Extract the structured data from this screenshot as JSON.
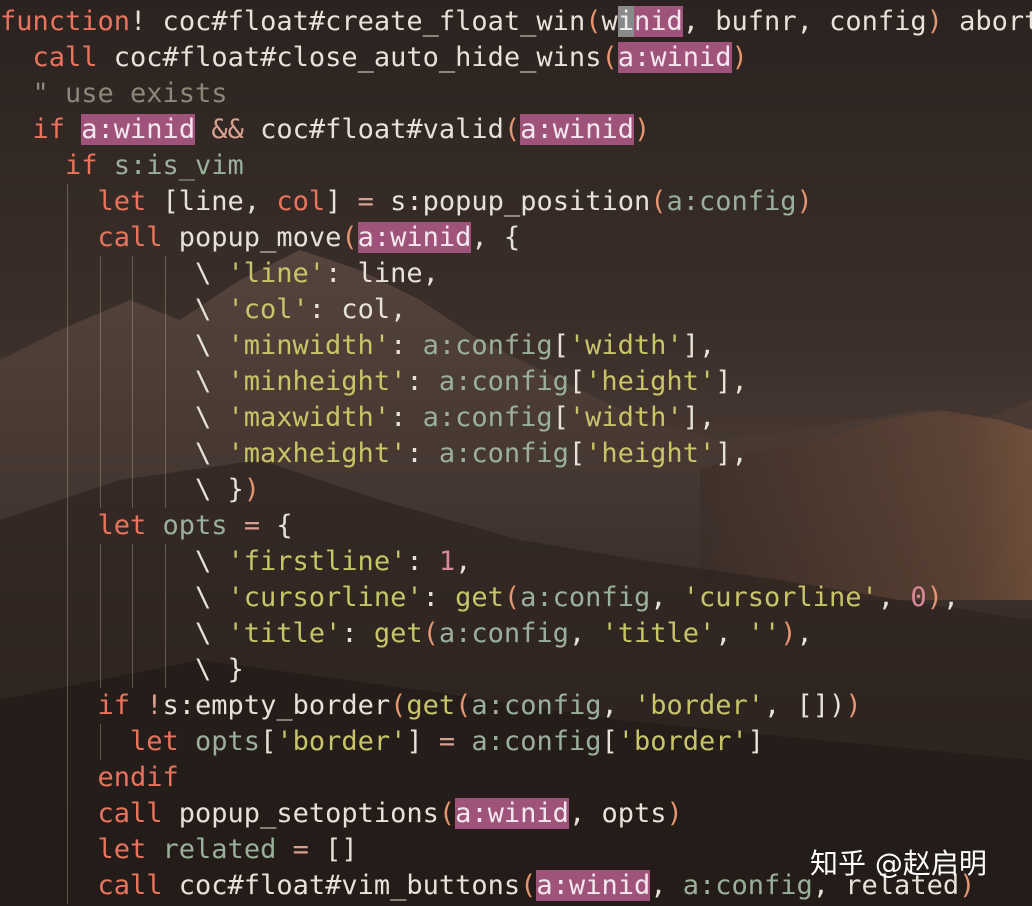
{
  "theme": {
    "background": "#2a2220",
    "keyword": "#e8745e",
    "string": "#c8c46a",
    "variable": "#9ab09a",
    "comment": "#8e8678",
    "number": "#d98a9a",
    "highlight": "#a0537a"
  },
  "editor": {
    "lines": [
      {
        "indent": 0,
        "tokens": [
          {
            "t": "function",
            "c": "kw"
          },
          {
            "t": "! coc#float#create_float_win",
            "c": "fn"
          },
          {
            "t": "(",
            "c": "paren"
          },
          {
            "t": "w",
            "c": "fn"
          },
          {
            "t": "i",
            "c": "cur"
          },
          {
            "t": "nid",
            "c": "hl"
          },
          {
            "t": ", bufnr, config",
            "c": "fn"
          },
          {
            "t": ")",
            "c": "paren"
          },
          {
            "t": " abort",
            "c": "fn"
          }
        ]
      },
      {
        "indent": 1,
        "tokens": [
          {
            "t": "call",
            "c": "kw"
          },
          {
            "t": " coc#float#close_auto_hide_wins",
            "c": "fn"
          },
          {
            "t": "(",
            "c": "paren"
          },
          {
            "t": "a:winid",
            "c": "hl"
          },
          {
            "t": ")",
            "c": "paren"
          }
        ]
      },
      {
        "indent": 1,
        "tokens": [
          {
            "t": "\" use exists",
            "c": "cmt"
          }
        ]
      },
      {
        "indent": 1,
        "tokens": [
          {
            "t": "if",
            "c": "kw"
          },
          {
            "t": " ",
            "c": "fn"
          },
          {
            "t": "a:winid",
            "c": "hl"
          },
          {
            "t": " && ",
            "c": "op"
          },
          {
            "t": "coc#float#valid",
            "c": "fn"
          },
          {
            "t": "(",
            "c": "paren"
          },
          {
            "t": "a:winid",
            "c": "hl"
          },
          {
            "t": ")",
            "c": "paren"
          }
        ]
      },
      {
        "indent": 2,
        "tokens": [
          {
            "t": "if",
            "c": "kw"
          },
          {
            "t": " s:is_vim",
            "c": "var"
          }
        ]
      },
      {
        "indent": 3,
        "tokens": [
          {
            "t": "let",
            "c": "kw"
          },
          {
            "t": " [line, ",
            "c": "fn"
          },
          {
            "t": "col",
            "c": "kw"
          },
          {
            "t": "] ",
            "c": "fn"
          },
          {
            "t": "=",
            "c": "op"
          },
          {
            "t": " s:popup_position",
            "c": "fn"
          },
          {
            "t": "(",
            "c": "paren"
          },
          {
            "t": "a:config",
            "c": "var"
          },
          {
            "t": ")",
            "c": "paren"
          }
        ]
      },
      {
        "indent": 3,
        "tokens": [
          {
            "t": "call",
            "c": "kw"
          },
          {
            "t": " popup_move",
            "c": "fn"
          },
          {
            "t": "(",
            "c": "paren"
          },
          {
            "t": "a:winid",
            "c": "hl"
          },
          {
            "t": ", {",
            "c": "fn"
          }
        ]
      },
      {
        "indent": 6,
        "tokens": [
          {
            "t": "\\ ",
            "c": "fn"
          },
          {
            "t": "'line'",
            "c": "str"
          },
          {
            "t": ": line,",
            "c": "fn"
          }
        ]
      },
      {
        "indent": 6,
        "tokens": [
          {
            "t": "\\ ",
            "c": "fn"
          },
          {
            "t": "'col'",
            "c": "str"
          },
          {
            "t": ": col,",
            "c": "fn"
          }
        ]
      },
      {
        "indent": 6,
        "tokens": [
          {
            "t": "\\ ",
            "c": "fn"
          },
          {
            "t": "'minwidth'",
            "c": "str"
          },
          {
            "t": ": ",
            "c": "fn"
          },
          {
            "t": "a:config",
            "c": "var"
          },
          {
            "t": "[",
            "c": "fn"
          },
          {
            "t": "'width'",
            "c": "str"
          },
          {
            "t": "],",
            "c": "fn"
          }
        ]
      },
      {
        "indent": 6,
        "tokens": [
          {
            "t": "\\ ",
            "c": "fn"
          },
          {
            "t": "'minheight'",
            "c": "str"
          },
          {
            "t": ": ",
            "c": "fn"
          },
          {
            "t": "a:config",
            "c": "var"
          },
          {
            "t": "[",
            "c": "fn"
          },
          {
            "t": "'height'",
            "c": "str"
          },
          {
            "t": "],",
            "c": "fn"
          }
        ]
      },
      {
        "indent": 6,
        "tokens": [
          {
            "t": "\\ ",
            "c": "fn"
          },
          {
            "t": "'maxwidth'",
            "c": "str"
          },
          {
            "t": ": ",
            "c": "fn"
          },
          {
            "t": "a:config",
            "c": "var"
          },
          {
            "t": "[",
            "c": "fn"
          },
          {
            "t": "'width'",
            "c": "str"
          },
          {
            "t": "],",
            "c": "fn"
          }
        ]
      },
      {
        "indent": 6,
        "tokens": [
          {
            "t": "\\ ",
            "c": "fn"
          },
          {
            "t": "'maxheight'",
            "c": "str"
          },
          {
            "t": ": ",
            "c": "fn"
          },
          {
            "t": "a:config",
            "c": "var"
          },
          {
            "t": "[",
            "c": "fn"
          },
          {
            "t": "'height'",
            "c": "str"
          },
          {
            "t": "],",
            "c": "fn"
          }
        ]
      },
      {
        "indent": 6,
        "tokens": [
          {
            "t": "\\ }",
            "c": "fn"
          },
          {
            "t": ")",
            "c": "paren"
          }
        ]
      },
      {
        "indent": 3,
        "tokens": [
          {
            "t": "let",
            "c": "kw"
          },
          {
            "t": " opts ",
            "c": "var"
          },
          {
            "t": "=",
            "c": "op"
          },
          {
            "t": " {",
            "c": "fn"
          }
        ]
      },
      {
        "indent": 6,
        "tokens": [
          {
            "t": "\\ ",
            "c": "fn"
          },
          {
            "t": "'firstline'",
            "c": "str"
          },
          {
            "t": ": ",
            "c": "fn"
          },
          {
            "t": "1",
            "c": "num"
          },
          {
            "t": ",",
            "c": "fn"
          }
        ]
      },
      {
        "indent": 6,
        "tokens": [
          {
            "t": "\\ ",
            "c": "fn"
          },
          {
            "t": "'cursorline'",
            "c": "str"
          },
          {
            "t": ": ",
            "c": "fn"
          },
          {
            "t": "get",
            "c": "str"
          },
          {
            "t": "(",
            "c": "paren"
          },
          {
            "t": "a:config",
            "c": "var"
          },
          {
            "t": ", ",
            "c": "fn"
          },
          {
            "t": "'cursorline'",
            "c": "str"
          },
          {
            "t": ", ",
            "c": "fn"
          },
          {
            "t": "0",
            "c": "num"
          },
          {
            "t": ")",
            "c": "paren"
          },
          {
            "t": ",",
            "c": "fn"
          }
        ]
      },
      {
        "indent": 6,
        "tokens": [
          {
            "t": "\\ ",
            "c": "fn"
          },
          {
            "t": "'title'",
            "c": "str"
          },
          {
            "t": ": ",
            "c": "fn"
          },
          {
            "t": "get",
            "c": "str"
          },
          {
            "t": "(",
            "c": "paren"
          },
          {
            "t": "a:config",
            "c": "var"
          },
          {
            "t": ", ",
            "c": "fn"
          },
          {
            "t": "'title'",
            "c": "str"
          },
          {
            "t": ", ",
            "c": "fn"
          },
          {
            "t": "''",
            "c": "str"
          },
          {
            "t": ")",
            "c": "paren"
          },
          {
            "t": ",",
            "c": "fn"
          }
        ]
      },
      {
        "indent": 6,
        "tokens": [
          {
            "t": "\\ }",
            "c": "fn"
          }
        ]
      },
      {
        "indent": 3,
        "tokens": [
          {
            "t": "if",
            "c": "kw"
          },
          {
            "t": " !",
            "c": "op"
          },
          {
            "t": "s:empty_border",
            "c": "fn"
          },
          {
            "t": "(",
            "c": "paren"
          },
          {
            "t": "get",
            "c": "str"
          },
          {
            "t": "(",
            "c": "paren"
          },
          {
            "t": "a:config",
            "c": "var"
          },
          {
            "t": ", ",
            "c": "fn"
          },
          {
            "t": "'border'",
            "c": "str"
          },
          {
            "t": ", [])",
            "c": "fn"
          },
          {
            "t": ")",
            "c": "paren"
          }
        ]
      },
      {
        "indent": 4,
        "tokens": [
          {
            "t": "let",
            "c": "kw"
          },
          {
            "t": " opts",
            "c": "var"
          },
          {
            "t": "[",
            "c": "fn"
          },
          {
            "t": "'border'",
            "c": "str"
          },
          {
            "t": "] ",
            "c": "fn"
          },
          {
            "t": "=",
            "c": "op"
          },
          {
            "t": " ",
            "c": "fn"
          },
          {
            "t": "a:config",
            "c": "var"
          },
          {
            "t": "[",
            "c": "fn"
          },
          {
            "t": "'border'",
            "c": "str"
          },
          {
            "t": "]",
            "c": "fn"
          }
        ]
      },
      {
        "indent": 3,
        "tokens": [
          {
            "t": "endif",
            "c": "kw"
          }
        ]
      },
      {
        "indent": 3,
        "tokens": [
          {
            "t": "call",
            "c": "kw"
          },
          {
            "t": " popup_setoptions",
            "c": "fn"
          },
          {
            "t": "(",
            "c": "paren"
          },
          {
            "t": "a:winid",
            "c": "hl"
          },
          {
            "t": ", opts",
            "c": "fn"
          },
          {
            "t": ")",
            "c": "paren"
          }
        ]
      },
      {
        "indent": 3,
        "tokens": [
          {
            "t": "let",
            "c": "kw"
          },
          {
            "t": " related ",
            "c": "var"
          },
          {
            "t": "=",
            "c": "op"
          },
          {
            "t": " []",
            "c": "fn"
          }
        ]
      },
      {
        "indent": 3,
        "tokens": [
          {
            "t": "call",
            "c": "kw"
          },
          {
            "t": " coc#float#vim_buttons",
            "c": "fn"
          },
          {
            "t": "(",
            "c": "paren"
          },
          {
            "t": "a:winid",
            "c": "hl"
          },
          {
            "t": ", ",
            "c": "fn"
          },
          {
            "t": "a:config",
            "c": "var"
          },
          {
            "t": ", related",
            "c": "fn"
          },
          {
            "t": ")",
            "c": "paren"
          }
        ]
      }
    ]
  },
  "watermark": {
    "text": "知乎 @赵启明"
  }
}
